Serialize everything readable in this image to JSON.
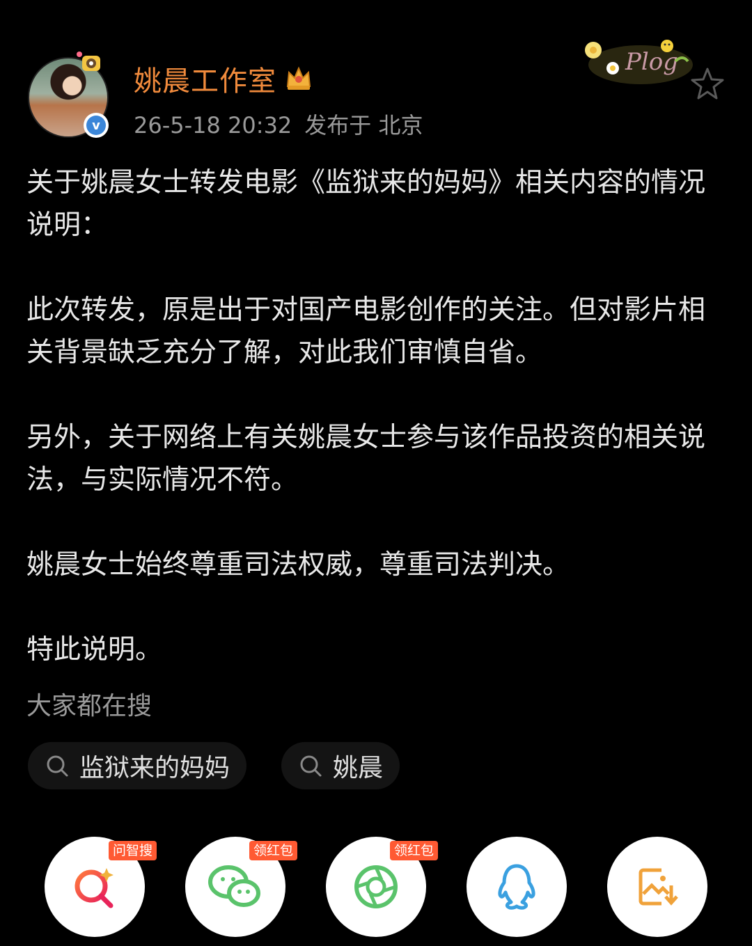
{
  "profile": {
    "name": "姚晨工作室",
    "time": "26-5-18 20:32",
    "location": "发布于 北京"
  },
  "decor": {
    "plog_text": "Plog"
  },
  "post": {
    "paragraphs": [
      "关于姚晨女士转发电影《监狱来的妈妈》相关内容的情况说明：",
      "此次转发，原是出于对国产电影创作的关注。但对影片相关背景缺乏充分了解，对此我们审慎自省。",
      "另外，关于网络上有关姚晨女士参与该作品投资的相关说法，与实际情况不符。",
      "姚晨女士始终尊重司法权威，尊重司法判决。",
      "特此说明。"
    ]
  },
  "hot_search": {
    "title": "大家都在搜",
    "items": [
      "监狱来的妈妈",
      "姚晨"
    ]
  },
  "share": {
    "badges": [
      "问智搜",
      "领红包",
      "领红包"
    ]
  },
  "colors": {
    "name_orange": "#f08a3c",
    "badge_red": "#ff5a33",
    "wechat_green": "#5ac36b",
    "qq_blue": "#3aa0e0",
    "save_orange": "#f0a23a"
  }
}
